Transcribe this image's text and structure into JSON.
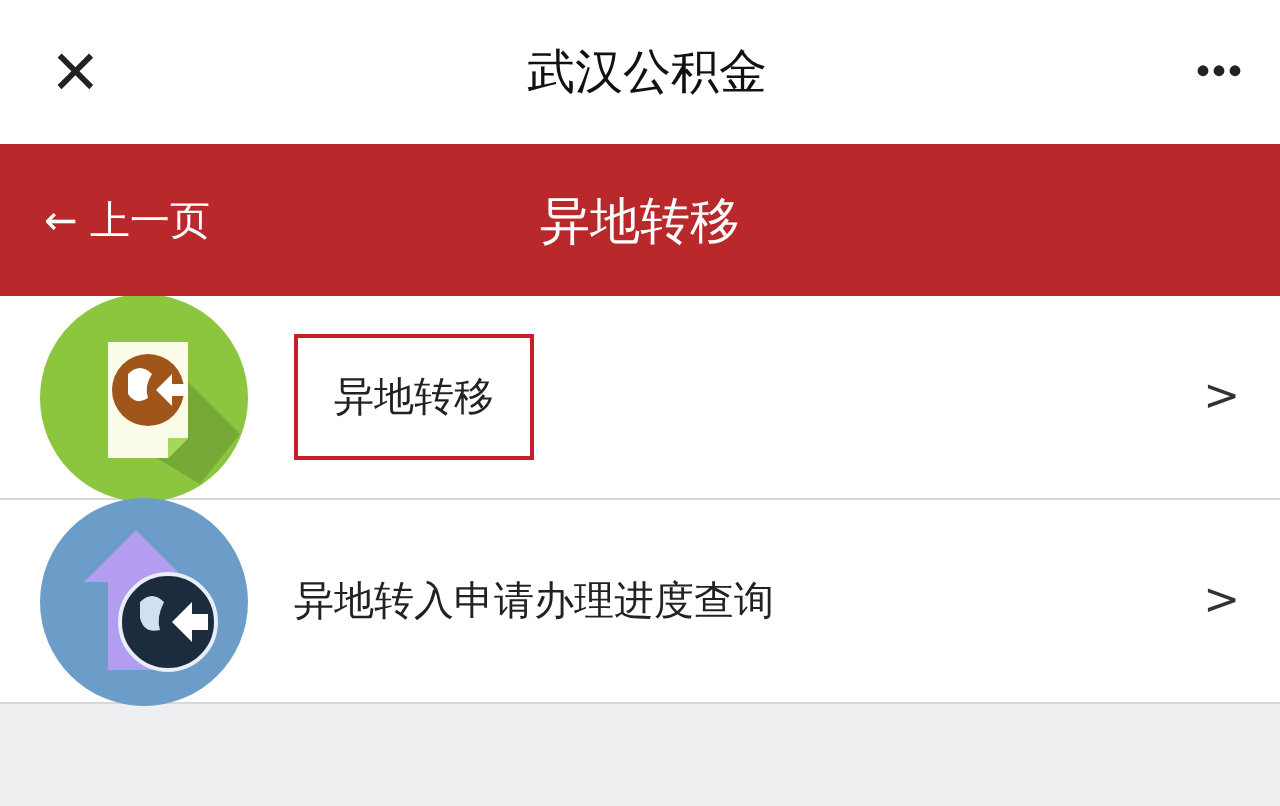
{
  "top_bar": {
    "close": "×",
    "title": "武汉公积金",
    "more": "•••"
  },
  "header": {
    "back": "← 上一页",
    "title": "异地转移"
  },
  "items": [
    {
      "kind": "document-globe",
      "label": "异地转移",
      "arrow": ">",
      "highlighted": true
    },
    {
      "kind": "upload-globe",
      "label": "异地转入申请办理进度查询",
      "arrow": ">",
      "highlighted": false
    }
  ]
}
